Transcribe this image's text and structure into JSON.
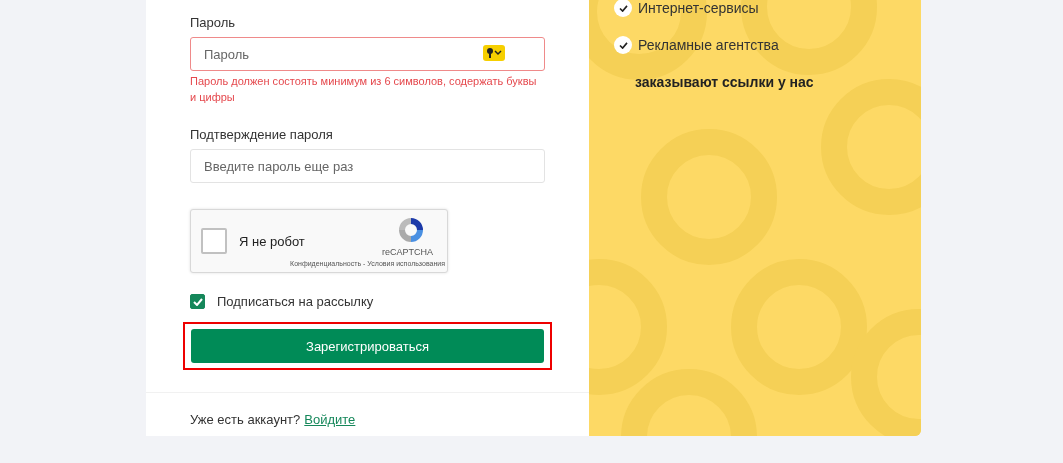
{
  "password": {
    "label": "Пароль",
    "placeholder": "Пароль",
    "invalid": true,
    "error": "Пароль должен состоять минимум из 6 символов, содержать буквы и цифры"
  },
  "confirm": {
    "label": "Подтверждение пароля",
    "placeholder": "Введите пароль еще раз",
    "invalid": false
  },
  "captcha": {
    "label": "Я не робот",
    "checked": false,
    "brand": "reCAPTCHA",
    "legal": "Конфиденциальность - Условия использования"
  },
  "newsletter": {
    "label": "Подписаться на рассылку",
    "checked": true
  },
  "submit": {
    "label": "Зарегистрироваться",
    "highlighted": true
  },
  "login_prompt": {
    "text": "Уже есть аккаунт?",
    "link": "Войдите"
  },
  "promo": {
    "items": [
      {
        "label": "Интернет-сервисы",
        "checked": true
      },
      {
        "label": "Рекламные агентства",
        "checked": true
      }
    ],
    "tagline": "заказывают ссылки у нас"
  }
}
